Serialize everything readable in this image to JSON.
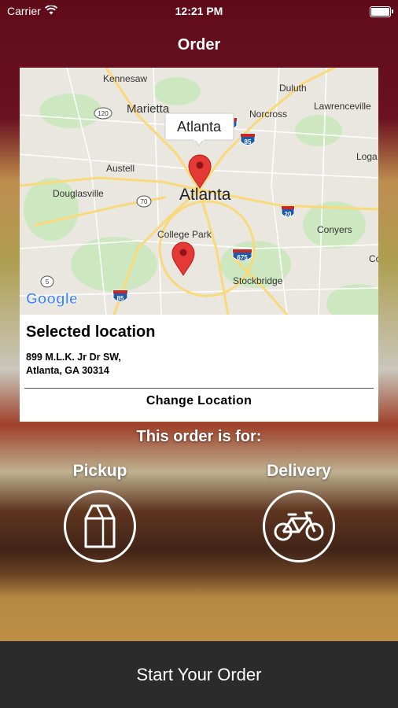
{
  "status_bar": {
    "carrier": "Carrier",
    "time": "12:21 PM",
    "battery_level": 1.0
  },
  "nav": {
    "title": "Order"
  },
  "map": {
    "callout": "Atlanta",
    "labels": {
      "kennesaw": "Kennesaw",
      "marietta": "Marietta",
      "duluth": "Duluth",
      "lawrenceville": "Lawrenceville",
      "norcross": "Norcross",
      "austell": "Austell",
      "douglasville": "Douglasville",
      "atlanta": "Atlanta",
      "logan": "Loga",
      "conyers": "Conyers",
      "college_park": "College Park",
      "stockbridge": "Stockbridge",
      "edge_c": "Co",
      "google": "Google"
    },
    "shields": {
      "r120": "120",
      "r70": "70",
      "r5": "5",
      "i85_n": "85",
      "i20": "20",
      "i675": "675",
      "i85_s": "85"
    },
    "colors": {
      "land": "#eae7e0",
      "park": "#cde8c1",
      "road": "#f9d97a",
      "pin": "#e53935"
    }
  },
  "location": {
    "heading": "Selected location",
    "address_line1": "899 M.L.K. Jr Dr SW,",
    "address_line2": "Atlanta, GA 30314",
    "change_label": "Change Location"
  },
  "order_for": {
    "heading": "This order is for:",
    "pickup_label": "Pickup",
    "delivery_label": "Delivery"
  },
  "cta": {
    "label": "Start Your Order"
  }
}
